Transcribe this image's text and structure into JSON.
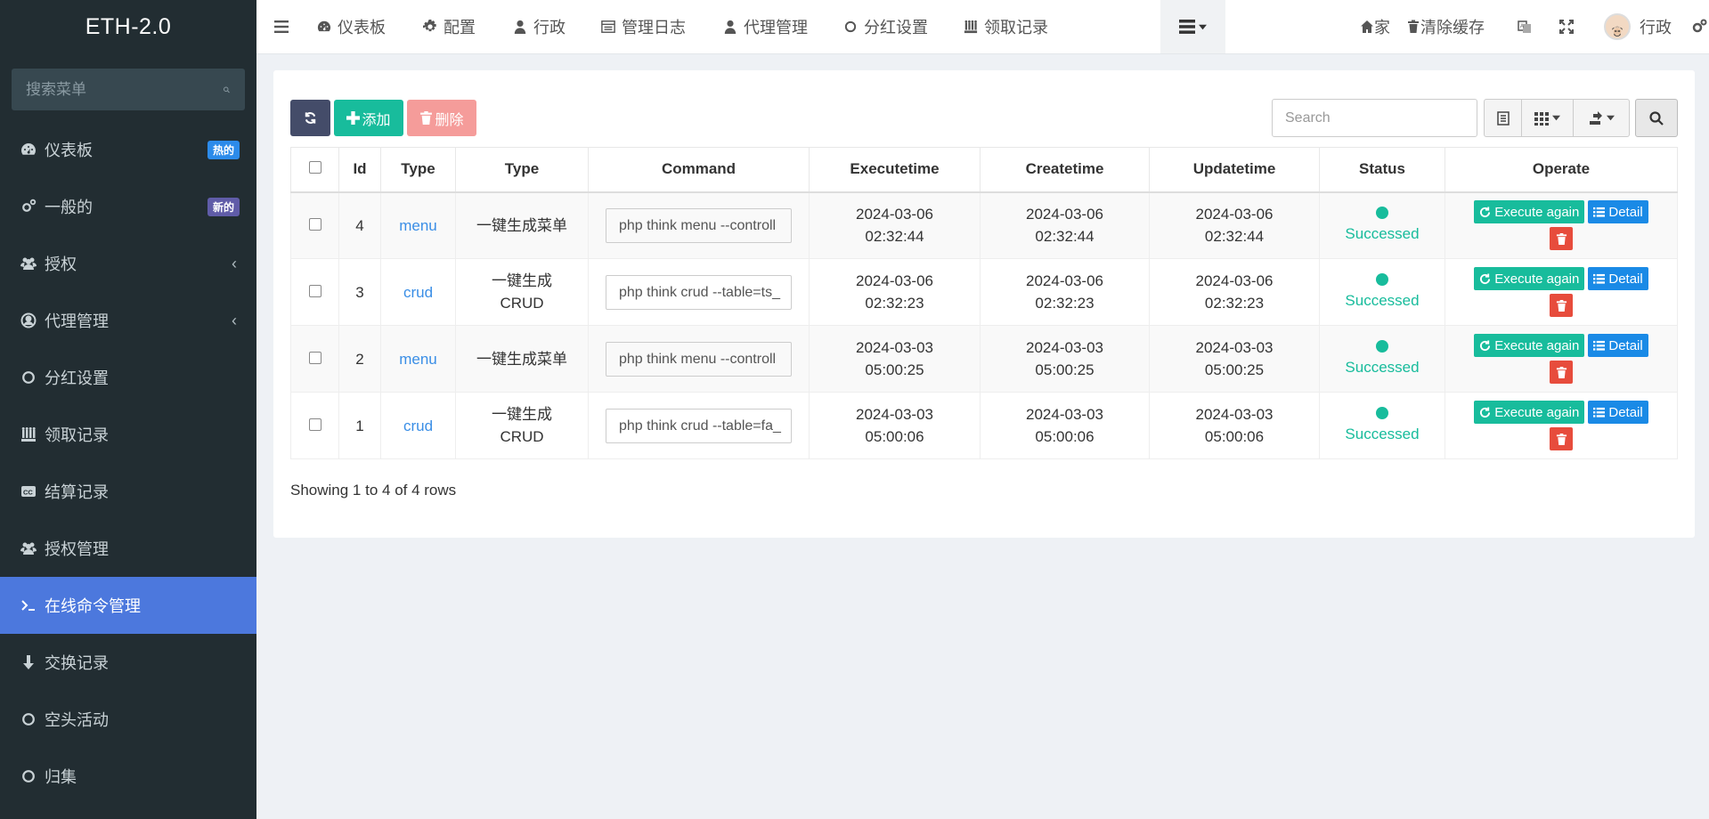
{
  "app": {
    "brand": "ETH-2.0"
  },
  "sidebar": {
    "search_placeholder": "搜索菜单",
    "items": [
      {
        "label": "仪表板",
        "icon": "dashboard-icon",
        "badge": "热的",
        "badge_color": "#2c8bea"
      },
      {
        "label": "一般的",
        "icon": "cogs-icon",
        "badge": "新的",
        "badge_color": "#605ca8"
      },
      {
        "label": "授权",
        "icon": "users-icon",
        "chevron": true
      },
      {
        "label": "代理管理",
        "icon": "user-circle-icon",
        "chevron": true
      },
      {
        "label": "分红设置",
        "icon": "circle-icon"
      },
      {
        "label": "领取记录",
        "icon": "group-icon"
      },
      {
        "label": "结算记录",
        "icon": "cc-icon"
      },
      {
        "label": "授权管理",
        "icon": "users-icon"
      },
      {
        "label": "在线命令管理",
        "icon": "terminal-icon",
        "active": true
      },
      {
        "label": "交换记录",
        "icon": "arrow-down-icon"
      },
      {
        "label": "空头活动",
        "icon": "circle-icon"
      },
      {
        "label": "归集",
        "icon": "circle-icon"
      }
    ]
  },
  "topnav": {
    "items": [
      {
        "label": "仪表板",
        "icon": "dashboard-icon"
      },
      {
        "label": "配置",
        "icon": "gear-icon"
      },
      {
        "label": "行政",
        "icon": "user-icon"
      },
      {
        "label": "管理日志",
        "icon": "list-icon"
      },
      {
        "label": "代理管理",
        "icon": "user-icon"
      },
      {
        "label": "分红设置",
        "icon": "circle-icon"
      },
      {
        "label": "领取记录",
        "icon": "group-icon"
      }
    ],
    "right": {
      "home": "家",
      "clear_cache": "清除缓存",
      "user": "行政"
    }
  },
  "toolbar": {
    "add_label": "添加",
    "delete_label": "删除",
    "search_placeholder": "Search"
  },
  "table": {
    "columns": [
      "Id",
      "Type",
      "Type",
      "Command",
      "Executetime",
      "Createtime",
      "Updatetime",
      "Status",
      "Operate"
    ],
    "rows": [
      {
        "id": "4",
        "type": "menu",
        "type_name": "一键生成菜单",
        "command": "php think menu --controll",
        "exec_date": "2024-03-06",
        "exec_time": "02:32:44",
        "create_date": "2024-03-06",
        "create_time": "02:32:44",
        "update_date": "2024-03-06",
        "update_time": "02:32:44",
        "status": "Successed"
      },
      {
        "id": "3",
        "type": "crud",
        "type_name": "一键生成 CRUD",
        "command": "php think crud --table=ts_",
        "exec_date": "2024-03-06",
        "exec_time": "02:32:23",
        "create_date": "2024-03-06",
        "create_time": "02:32:23",
        "update_date": "2024-03-06",
        "update_time": "02:32:23",
        "status": "Successed"
      },
      {
        "id": "2",
        "type": "menu",
        "type_name": "一键生成菜单",
        "command": "php think menu --controll",
        "exec_date": "2024-03-03",
        "exec_time": "05:00:25",
        "create_date": "2024-03-03",
        "create_time": "05:00:25",
        "update_date": "2024-03-03",
        "update_time": "05:00:25",
        "status": "Successed"
      },
      {
        "id": "1",
        "type": "crud",
        "type_name": "一键生成 CRUD",
        "command": "php think crud --table=fa_",
        "exec_date": "2024-03-03",
        "exec_time": "05:00:06",
        "create_date": "2024-03-03",
        "create_time": "05:00:06",
        "update_date": "2024-03-03",
        "update_time": "05:00:06",
        "status": "Successed"
      }
    ],
    "op_execute": "Execute again",
    "op_detail": "Detail"
  },
  "pagination": {
    "info": "Showing 1 to 4 of 4 rows"
  },
  "colors": {
    "accent": "#4c78dd",
    "success": "#18bc9c",
    "danger": "#e74c3c",
    "primary": "#1a8ae6"
  }
}
